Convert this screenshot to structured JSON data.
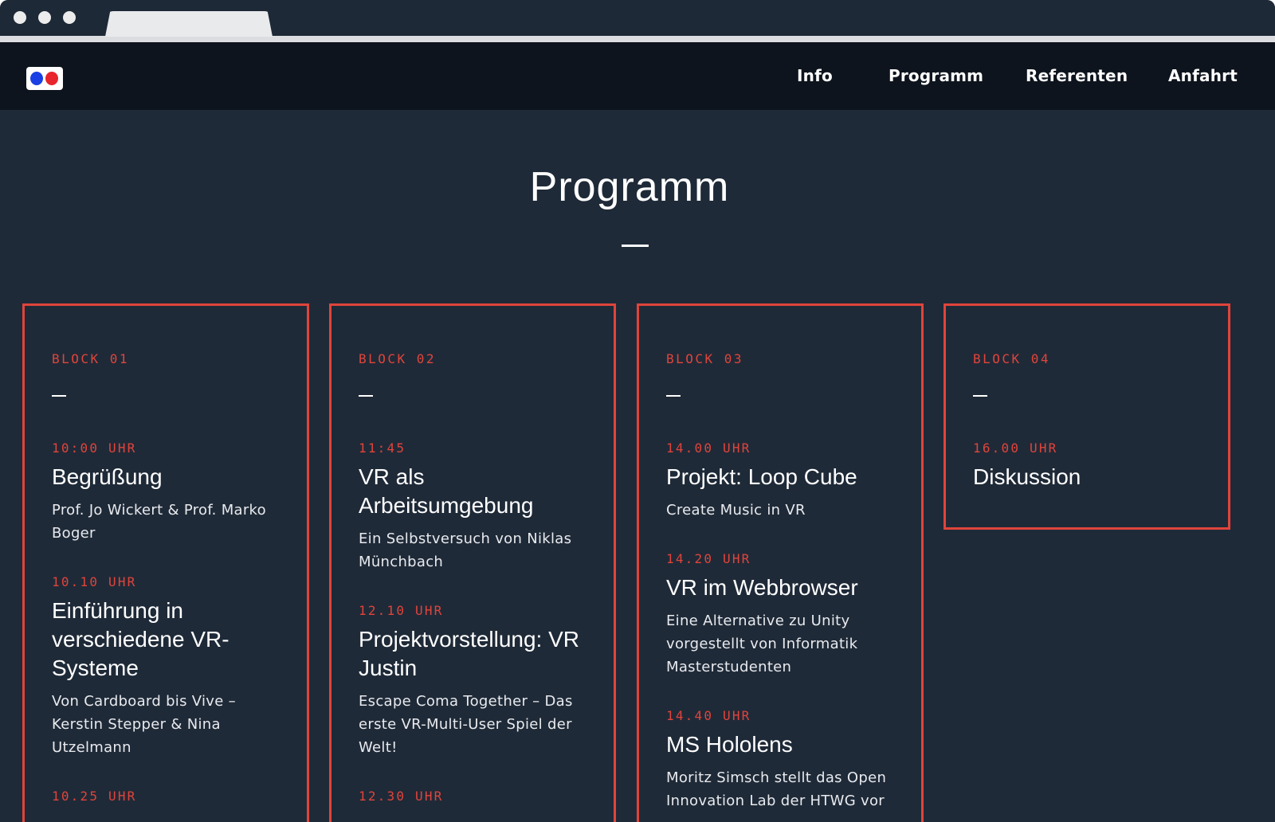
{
  "nav": {
    "links": [
      "Info",
      "Programm",
      "Referenten",
      "Anfahrt"
    ]
  },
  "page": {
    "title": "Programm"
  },
  "colors": {
    "accent": "#e0443b",
    "background": "#1f2a38",
    "navbar": "#0e141d"
  },
  "blocks": [
    {
      "label": "BLOCK 01",
      "items": [
        {
          "time": "10:00 UHR",
          "title": "Begrüßung",
          "subtitle": "Prof. Jo Wickert & Prof. Marko Boger"
        },
        {
          "time": "10.10 UHR",
          "title": "Einführung in verschiedene VR-Systeme",
          "subtitle": "Von Cardboard bis Vive – Kerstin Stepper & Nina Utzelmann"
        },
        {
          "time": "10.25 UHR",
          "title": "",
          "subtitle": ""
        }
      ]
    },
    {
      "label": "BLOCK 02",
      "items": [
        {
          "time": "11:45",
          "title": "VR als Arbeitsumgebung",
          "subtitle": "Ein Selbstversuch von Niklas Münchbach"
        },
        {
          "time": "12.10 UHR",
          "title": "Projektvorstellung: VR Justin",
          "subtitle": "Escape Coma Together – Das erste VR-Multi-User Spiel der Welt!"
        },
        {
          "time": "12.30 UHR",
          "title": "",
          "subtitle": ""
        }
      ]
    },
    {
      "label": "BLOCK 03",
      "items": [
        {
          "time": "14.00 UHR",
          "title": "Projekt: Loop Cube",
          "subtitle": "Create Music in VR"
        },
        {
          "time": "14.20 UHR",
          "title": "VR im Webbrowser",
          "subtitle": "Eine Alternative zu Unity vorgestellt von Informatik Masterstudenten"
        },
        {
          "time": "14.40 UHR",
          "title": "MS Hololens",
          "subtitle": "Moritz Simsch stellt das Open Innovation Lab der HTWG vor"
        }
      ]
    },
    {
      "label": "BLOCK 04",
      "items": [
        {
          "time": "16.00 UHR",
          "title": "Diskussion",
          "subtitle": ""
        }
      ]
    }
  ]
}
